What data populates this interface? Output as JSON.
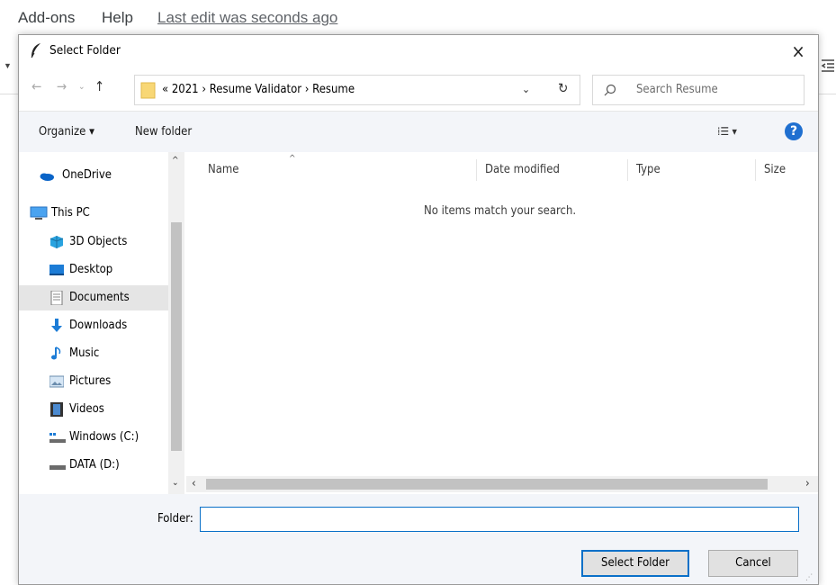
{
  "background_app": {
    "menu_items": [
      "Add-ons",
      "Help"
    ],
    "last_edit": "Last edit was seconds ago"
  },
  "dialog": {
    "title": "Select Folder",
    "close_label": "×",
    "address": {
      "path_text": "« 2021 › Resume Validator › Resume"
    },
    "search": {
      "placeholder": "Search Resume"
    },
    "toolbar": {
      "organize_label": "Organize ▾",
      "new_folder_label": "New folder",
      "view_label": "⁞☰ ▾",
      "help_label": "?"
    },
    "sidebar": {
      "items": [
        {
          "label": "OneDrive",
          "icon": "onedrive-icon"
        },
        {
          "label": "This PC",
          "icon": "pc-icon"
        },
        {
          "label": "3D Objects",
          "icon": "3d-objects-icon"
        },
        {
          "label": "Desktop",
          "icon": "desktop-icon"
        },
        {
          "label": "Documents",
          "icon": "documents-icon",
          "selected": true
        },
        {
          "label": "Downloads",
          "icon": "downloads-icon"
        },
        {
          "label": "Music",
          "icon": "music-icon"
        },
        {
          "label": "Pictures",
          "icon": "pictures-icon"
        },
        {
          "label": "Videos",
          "icon": "videos-icon"
        },
        {
          "label": "Windows (C:)",
          "icon": "drive-c-icon"
        },
        {
          "label": "DATA (D:)",
          "icon": "drive-d-icon"
        }
      ]
    },
    "columns": [
      "Name",
      "Date modified",
      "Type",
      "Size"
    ],
    "empty_message": "No items match your search.",
    "folder_label": "Folder:",
    "folder_value": "",
    "select_button": "Select Folder",
    "cancel_button": "Cancel"
  },
  "colors": {
    "accent": "#0a70c8",
    "help": "#1f6fd0",
    "folder": "#f8d775"
  }
}
